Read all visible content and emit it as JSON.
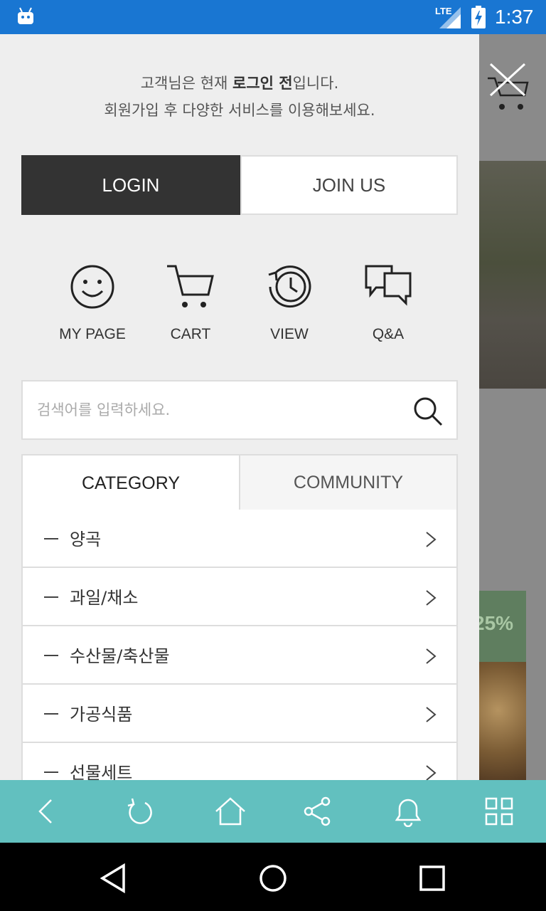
{
  "status_bar": {
    "time": "1:37",
    "network": "LTE",
    "icons": [
      "android-icon",
      "signal-icon",
      "battery-charging-icon"
    ]
  },
  "drawer": {
    "notice_prefix": "고객님은 현재 ",
    "notice_bold": "로그인 전",
    "notice_suffix": "입니다.",
    "notice_line2": "회원가입 후 다양한 서비스를 이용해보세요.",
    "login_label": "LOGIN",
    "join_label": "JOIN US",
    "quick_links": [
      {
        "label": "MY PAGE",
        "icon": "smiley-icon"
      },
      {
        "label": "CART",
        "icon": "cart-icon"
      },
      {
        "label": "VIEW",
        "icon": "history-clock-icon"
      },
      {
        "label": "Q&A",
        "icon": "chat-bubbles-icon"
      }
    ],
    "search": {
      "placeholder": "검색어를 입력하세요.",
      "value": ""
    },
    "tabs": [
      {
        "label": "CATEGORY",
        "active": true
      },
      {
        "label": "COMMUNITY",
        "active": false
      }
    ],
    "categories": [
      "양곡",
      "과일/채소",
      "수산물/축산물",
      "가공식품",
      "선물세트"
    ]
  },
  "background_page": {
    "discount_text": "25%"
  },
  "app_toolbar": {
    "icons": [
      "back-icon",
      "refresh-icon",
      "home-icon",
      "share-icon",
      "bell-icon",
      "grid-menu-icon"
    ],
    "color": "#62c0bf"
  },
  "nav_bar": {
    "icons": [
      "back-triangle-icon",
      "home-circle-icon",
      "recents-square-icon"
    ]
  },
  "colors": {
    "status_bar": "#1976d2",
    "login_button": "#333333",
    "drawer_background": "#eeeeee"
  }
}
